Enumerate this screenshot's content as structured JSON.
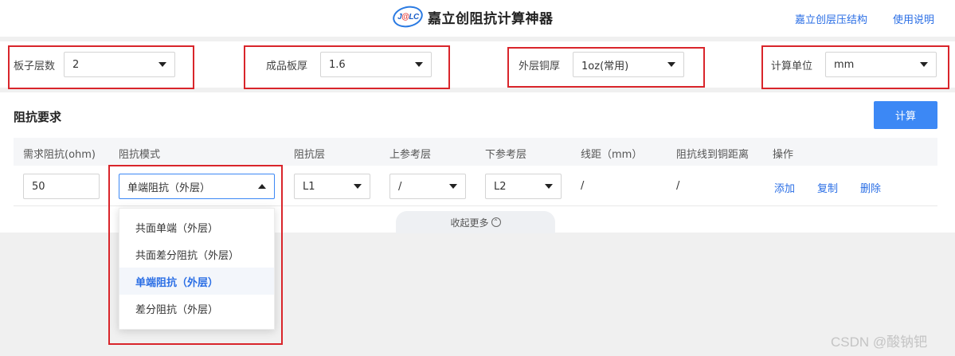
{
  "header": {
    "logo_mark_left": "J",
    "logo_mark_at": "@",
    "logo_mark_right": "LC",
    "title": "嘉立创阻抗计算神器",
    "links": [
      "嘉立创层压结构",
      "使用说明"
    ]
  },
  "settings": {
    "layers": {
      "label": "板子层数",
      "value": "2"
    },
    "thickness": {
      "label": "成品板厚",
      "value": "1.6"
    },
    "copper": {
      "label": "外层铜厚",
      "value": "1oz(常用)"
    },
    "unit": {
      "label": "计算单位",
      "value": "mm"
    }
  },
  "requirements": {
    "title": "阻抗要求",
    "calc_button": "计算",
    "columns": [
      "需求阻抗(ohm)",
      "阻抗模式",
      "阻抗层",
      "上参考层",
      "下参考层",
      "线距（mm）",
      "阻抗线到铜距离",
      "操作"
    ],
    "row": {
      "impedance": "50",
      "mode": "单端阻抗（外层）",
      "layer": "L1",
      "top_ref": "/",
      "bottom_ref": "L2",
      "spacing": "/",
      "copper_distance": "/",
      "actions": [
        "添加",
        "复制",
        "删除"
      ]
    },
    "collapse_label": "收起更多"
  },
  "mode_dropdown": {
    "options": [
      "共面单端（外层）",
      "共面差分阻抗（外层）",
      "单端阻抗（外层）",
      "差分阻抗（外层）"
    ],
    "selected_index": 2
  },
  "watermark": "CSDN @酸钠钯",
  "colors": {
    "accent": "#3c88f5",
    "link": "#2a6ee5",
    "highlight_box": "#d9252b"
  }
}
